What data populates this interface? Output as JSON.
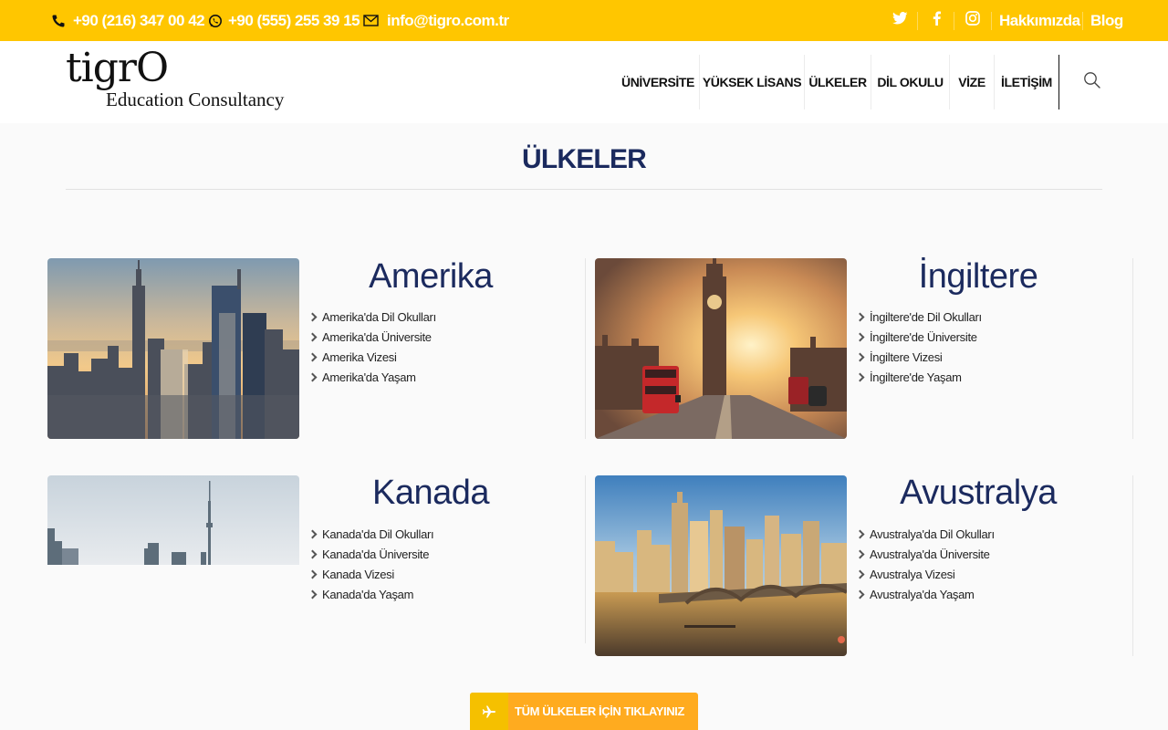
{
  "topbar": {
    "phone": "+90 (216) 347 00 42",
    "whatsapp": "+90 (555) 255 39 15",
    "email": "info@tigro.com.tr",
    "social": [
      "twitter-icon",
      "facebook-icon",
      "instagram-icon"
    ],
    "links": [
      "Hakkımızda",
      "Blog"
    ]
  },
  "header": {
    "logo_main": "tigrO",
    "logo_sub": "Education Consultancy",
    "nav": [
      "ÜNİVERSİTE",
      "YÜKSEK LİSANS",
      "ÜLKELER",
      "DİL OKULU",
      "VİZE",
      "İLETİŞİM"
    ],
    "search_icon": "search-icon"
  },
  "page": {
    "title": "ÜLKELER"
  },
  "countries": [
    {
      "name": "Amerika",
      "links": [
        "Amerika'da Dil Okulları",
        "Amerika'da Üniversite",
        "Amerika Vizesi",
        "Amerika'da Yaşam"
      ]
    },
    {
      "name": "İngiltere",
      "links": [
        "İngiltere'de Dil Okulları",
        "İngiltere'de Üniversite",
        "İngiltere Vizesi",
        "İngiltere'de Yaşam"
      ]
    },
    {
      "name": "Kanada",
      "links": [
        "Kanada'da Dil Okulları",
        "Kanada'da Üniversite",
        "Kanada Vizesi",
        "Kanada'da Yaşam"
      ]
    },
    {
      "name": "Avustralya",
      "links": [
        "Avustralya'da Dil Okulları",
        "Avustralya'da Üniversite",
        "Avustralya Vizesi",
        "Avustralya'da Yaşam"
      ]
    }
  ],
  "cta": {
    "label": "TÜM ÜLKELER İÇİN TIKLAYINIZ",
    "icon": "plane-icon"
  },
  "colors": {
    "topbar": "#ffc600",
    "heading": "#1b2a5e",
    "cta": "#ffab1f"
  }
}
